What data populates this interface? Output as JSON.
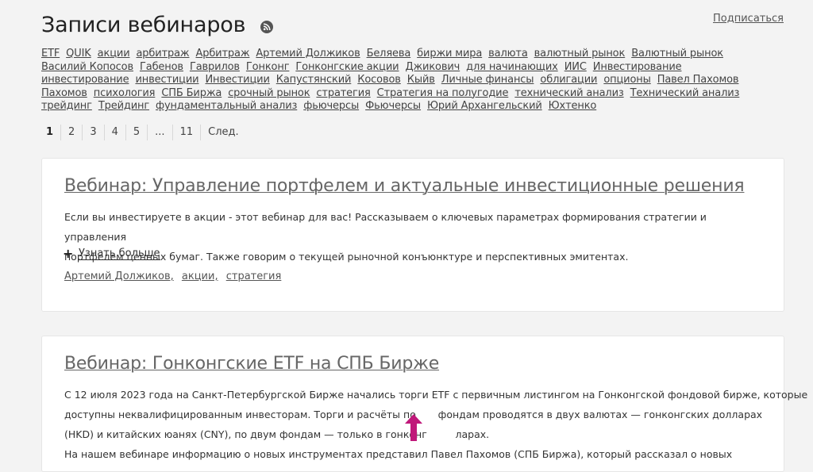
{
  "header": {
    "title": "Записи вебинаров",
    "subscribe": "Подписаться"
  },
  "tags": [
    "ETF",
    "QUIK",
    "акции",
    "арбитраж",
    "Арбитраж",
    "Артемий Должиков",
    "Беляева",
    "биржи мира",
    "валюта",
    "валютный рынок",
    "Валютный рынок",
    "Василий Копосов",
    "Габенов",
    "Гаврилов",
    "Гонконг",
    "Гонконгские акции",
    "Джикович",
    "для начинающих",
    "ИИС",
    "Инвестирование",
    "инвестирование",
    "инвестиции",
    "Инвестиции",
    "Капустянский",
    "Косовов",
    "Кыйв",
    "Личные финансы",
    "облигации",
    "опционы",
    "Павел Пахомов",
    "Пахомов",
    "психология",
    "СПБ Биржа",
    "срочный рынок",
    "стратегия",
    "Стратегия на полугодие",
    "технический анализ",
    "Технический анализ",
    "трейдинг",
    "Трейдинг",
    "фундаментальный анализ",
    "фьючерсы",
    "Фьючерсы",
    "Юрий Архангельский",
    "Юхтенко"
  ],
  "pagination": {
    "pages": [
      "1",
      "2",
      "3",
      "4",
      "5",
      "...",
      "11",
      "След."
    ],
    "active": "1"
  },
  "cards": [
    {
      "title": "Вебинар: Управление портфелем и актуальные инвестиционные решения",
      "desc_line1": "Если вы инвестируете в акции - этот вебинар для вас! Рассказываем о ключевых параметрах формирования стратегии и управления",
      "desc_line2": "портфелем ценных бумаг. Также говорим о текущей рыночной конъюнктуре и перспективных эмитентах.",
      "more": "Узнать больше",
      "tags": [
        "Артемий Должиков,",
        "акции,",
        "стратегия"
      ]
    },
    {
      "title": "Вебинар: Гонконгские ETF на СПБ Бирже",
      "desc_line1": "С 12 июля 2023 года на Санкт-Петербургской Бирже начались торги ETF с первичным листингом на Гонконгской фондовой бирже, которые",
      "desc_line2": "доступны неквалифицированным инвесторам. Торги и расчёты по       фондам проводятся в двух валютах — гонконгских долларах",
      "desc_line3": "(HKD) и китайских юанях (CNY), по двум фондам — только в гонконг         ларах.",
      "desc_line4": "На нашем вебинаре информацию о новых инструментах представил Павел Пахомов (СПБ Биржа), который рассказал о новых"
    }
  ],
  "colors": {
    "background": "#f3f3f3",
    "card": "#ffffff",
    "accent_arrow": "#c0187a"
  }
}
